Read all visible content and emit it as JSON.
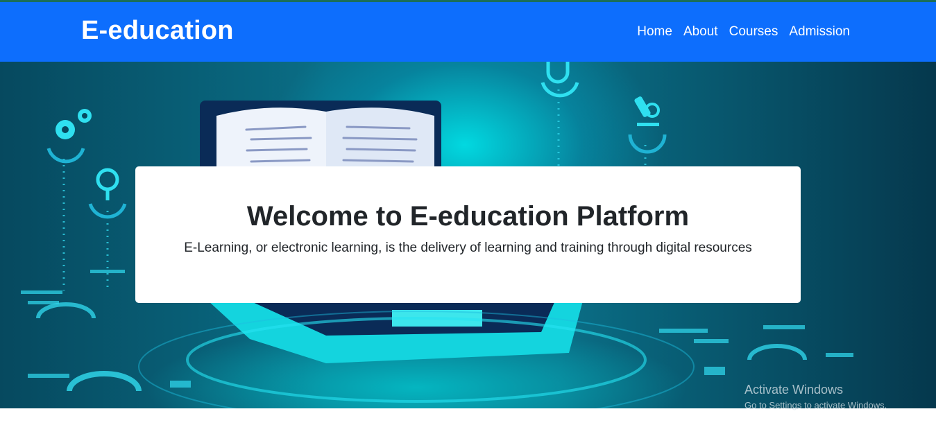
{
  "navbar": {
    "brand": "E-education",
    "links": [
      "Home",
      "About",
      "Courses",
      "Admission"
    ]
  },
  "hero": {
    "title": "Welcome to E-education Platform",
    "text": "E-Learning, or electronic learning, is the delivery of learning and training through digital resources"
  },
  "watermark": {
    "title": "Activate Windows",
    "subtitle": "Go to Settings to activate Windows."
  },
  "colors": {
    "navbar": "#0d6efd",
    "hero_dark": "#06495f",
    "hero_glow": "#00ebf0",
    "text": "#212529"
  },
  "icons": [
    "gear-icon",
    "magnifier-icon",
    "microscope-icon",
    "stethoscope-icon",
    "book-icon",
    "laptop-icon"
  ]
}
